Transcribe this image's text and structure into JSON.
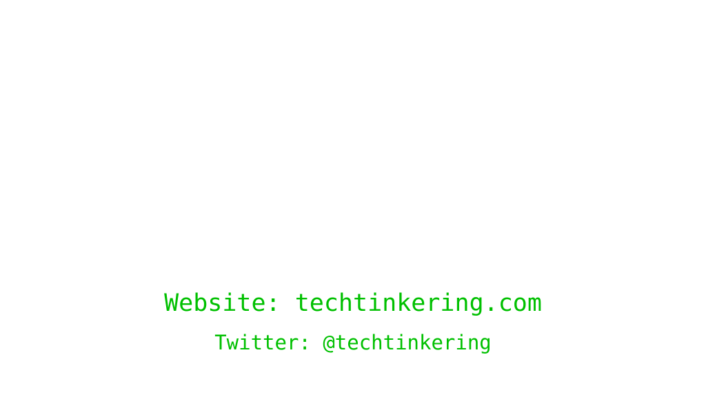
{
  "colors": {
    "background": "#ffffff",
    "text": "#00c000"
  },
  "contact": {
    "website_line": "Website: techtinkering.com",
    "twitter_line": "Twitter: @techtinkering"
  }
}
